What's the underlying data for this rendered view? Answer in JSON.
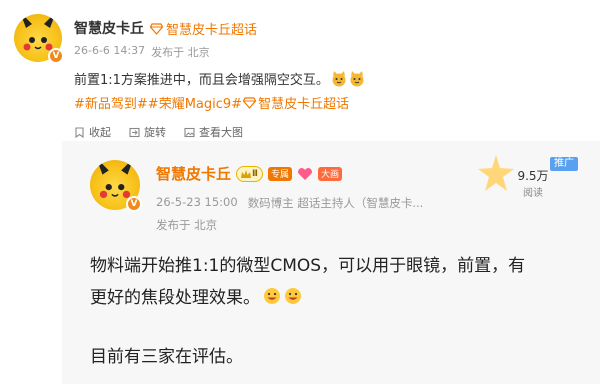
{
  "post": {
    "author": "智慧皮卡丘",
    "author_link_prefix_icon": "diamond-icon",
    "topic_link": "智慧皮卡丘超话",
    "date": "26-6-6 14:37",
    "location_label": "发布于 北京",
    "text": "前置1:1方案推进中，而且会增强隔空交互。",
    "emojis": [
      "cat-face-emoji",
      "cat-face-emoji"
    ],
    "hashtags": [
      "#新品驾到#",
      "#荣耀Magic9#"
    ],
    "topic_inline": "智慧皮卡丘超话",
    "actions": [
      {
        "icon": "bookmark-icon",
        "label": "收起"
      },
      {
        "icon": "repost-icon",
        "label": "旋转"
      },
      {
        "icon": "image-icon",
        "label": "查看大图"
      }
    ],
    "avatar_badge": "V"
  },
  "repost": {
    "author": "智慧皮卡丘",
    "level_badge": "Ⅱ",
    "badge_exclusive": "专属",
    "badge_big": "大画",
    "date": "26-5-23 15:00",
    "role": "数码博主 超话主持人（智慧皮卡...",
    "location_label": "发布于 北京",
    "views": "9.5万",
    "views_label": "阅读",
    "promote": "推广",
    "text_line1": "物料端开始推1:1的微型CMOS，可以用于眼镜，前置，有",
    "text_line2": "更好的焦段处理效果。",
    "text_line3": "目前有三家在评估。",
    "avatar_badge": "V"
  },
  "colors": {
    "accent": "#f07800",
    "muted": "#999999",
    "card_bg": "#f7f7f7",
    "link": "#f07800"
  }
}
